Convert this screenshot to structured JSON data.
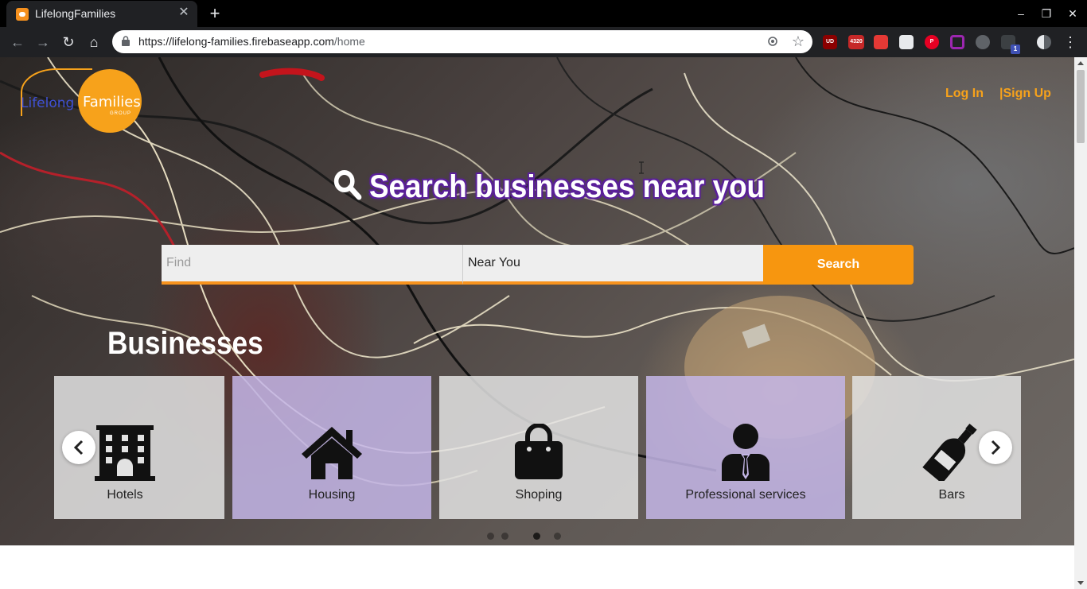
{
  "browser": {
    "tab_title": "LifelongFamilies",
    "tab_close": "✕",
    "new_tab": "+",
    "url_host": "https://lifelong-families.firebaseapp.com",
    "url_path": "/home",
    "extensions": [
      {
        "name": "ublock-icon",
        "label": "UD",
        "color": "#8b0000"
      },
      {
        "name": "counter-icon",
        "label": "4320",
        "color": "#c62828"
      },
      {
        "name": "video-icon",
        "label": "",
        "color": "#e53935"
      },
      {
        "name": "screenshot-icon",
        "label": "",
        "color": "#ffffff"
      },
      {
        "name": "pinterest-icon",
        "label": "P",
        "color": "#e60023"
      },
      {
        "name": "frame-icon",
        "label": "",
        "color": "#9c27b0"
      },
      {
        "name": "cloud-icon",
        "label": "",
        "color": "#9aa0a6"
      },
      {
        "name": "box-icon",
        "label": "1",
        "color": "#5f6368"
      }
    ]
  },
  "header": {
    "logo_word1": "Lifelong",
    "logo_word2": "Families",
    "logo_word3": "GROUP",
    "login": "Log In",
    "signup": "|Sign Up"
  },
  "hero": {
    "title": "Search businesses near you"
  },
  "search": {
    "find_placeholder": "Find",
    "near_value": "Near You",
    "button_label": "Search"
  },
  "businesses": {
    "title": "Businesses",
    "cards": [
      {
        "label": "Hotels",
        "icon": "hotel-icon",
        "tone": "grey"
      },
      {
        "label": "Housing",
        "icon": "house-icon",
        "tone": "purple"
      },
      {
        "label": "Shoping",
        "icon": "shopping-bag-icon",
        "tone": "grey"
      },
      {
        "label": "Professional services",
        "icon": "professional-icon",
        "tone": "purple"
      },
      {
        "label": "Bars",
        "icon": "bottle-icon",
        "tone": "grey"
      }
    ]
  }
}
